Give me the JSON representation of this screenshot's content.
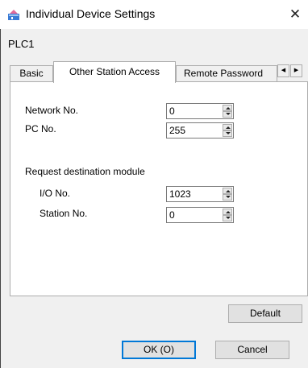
{
  "window": {
    "title": "Individual Device Settings",
    "close_glyph": "✕"
  },
  "device": {
    "name": "PLC1"
  },
  "tabs": [
    {
      "label": "Basic",
      "active": false
    },
    {
      "label": "Other Station Access",
      "active": true
    },
    {
      "label": "Remote Password",
      "active": false
    }
  ],
  "tab_scroll": {
    "left": "◀",
    "right": "▶"
  },
  "fields": {
    "network_no": {
      "label": "Network No.",
      "value": "0"
    },
    "pc_no": {
      "label": "PC No.",
      "value": "255"
    },
    "group_label": "Request destination module",
    "io_no": {
      "label": "I/O No.",
      "value": "1023"
    },
    "station_no": {
      "label": "Station No.",
      "value": "0"
    }
  },
  "buttons": {
    "default": "Default",
    "ok": "OK (O)",
    "cancel": "Cancel"
  },
  "colors": {
    "focus_border": "#0078d7",
    "panel": "#ffffff",
    "dialog": "#f0f0f0"
  }
}
